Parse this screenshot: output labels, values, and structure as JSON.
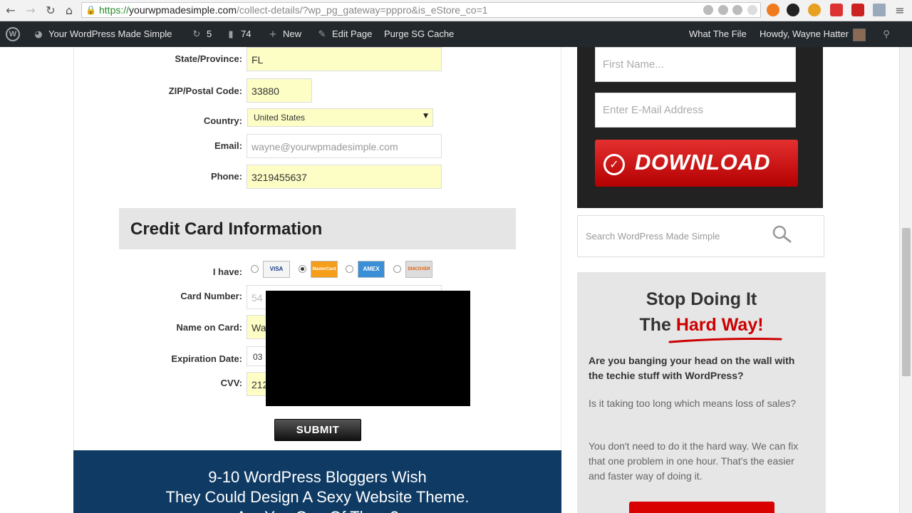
{
  "browser": {
    "url_protocol": "https://",
    "url_host": "yourwpmadesimple.com",
    "url_path": "/collect-details/?wp_pg_gateway=pppro&is_eStore_co=1"
  },
  "admin_bar": {
    "site_name": "Your WordPress Made Simple",
    "updates_count": "5",
    "comments_count": "74",
    "new_label": "New",
    "edit_page_label": "Edit Page",
    "purge_label": "Purge SG Cache",
    "what_the_file_label": "What The File",
    "howdy_label": "Howdy, Wayne Hatter"
  },
  "form": {
    "state_label": "State/Province:",
    "state_value": "FL",
    "zip_label": "ZIP/Postal Code:",
    "zip_value": "33880",
    "country_label": "Country:",
    "country_value": "United States",
    "email_label": "Email:",
    "email_value": "wayne@yourwpmadesimple.com",
    "phone_label": "Phone:",
    "phone_value": "3219455637"
  },
  "credit_card": {
    "heading": "Credit Card Information",
    "i_have_label": "I have:",
    "cards": [
      "VISA",
      "MasterCard",
      "AMEX",
      "DISCOVER"
    ],
    "selected_card": "MasterCard",
    "card_number_label": "Card Number:",
    "card_number_value": "54",
    "name_label": "Name on Card:",
    "name_value": "Wa",
    "expiration_label": "Expiration Date:",
    "expiration_value": "03",
    "cvv_label": "CVV:",
    "cvv_value": "212",
    "submit_label": "SUBMIT"
  },
  "banner": {
    "line1": "9-10 WordPress Bloggers Wish",
    "line2": "They Could Design A Sexy Website Theme.",
    "line3": "Are You One Of Them?"
  },
  "sidebar": {
    "first_name_placeholder": "First Name...",
    "email_placeholder": "Enter E-Mail Address",
    "download_label": "DOWNLOAD",
    "search_placeholder": "Search WordPress Made Simple",
    "promo_title_1": "Stop Doing It",
    "promo_title_2a": "The ",
    "promo_title_2b": "Hard Way!",
    "promo_p1": "Are you banging your head on the wall with the techie stuff with WordPress?",
    "promo_p2": "Is it taking too long which means loss of sales?",
    "promo_p3": "You don't need to do it the hard way. We can fix that one problem in one hour. That's the easier and faster way of doing it."
  },
  "colors": {
    "accent_red": "#c00000",
    "banner_blue": "#0e3a64",
    "field_yellow": "#fdfdc6"
  }
}
